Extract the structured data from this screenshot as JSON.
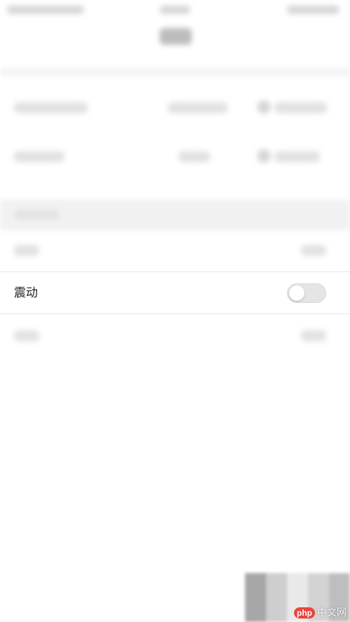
{
  "settings": {
    "vibrate": {
      "label": "震动",
      "enabled": false
    }
  },
  "watermark": {
    "badge": "php",
    "text": "中文网"
  },
  "colors": {
    "toggle_off_track": "#e5e5e5",
    "background": "#ffffff",
    "watermark_badge": "#e8453c"
  }
}
